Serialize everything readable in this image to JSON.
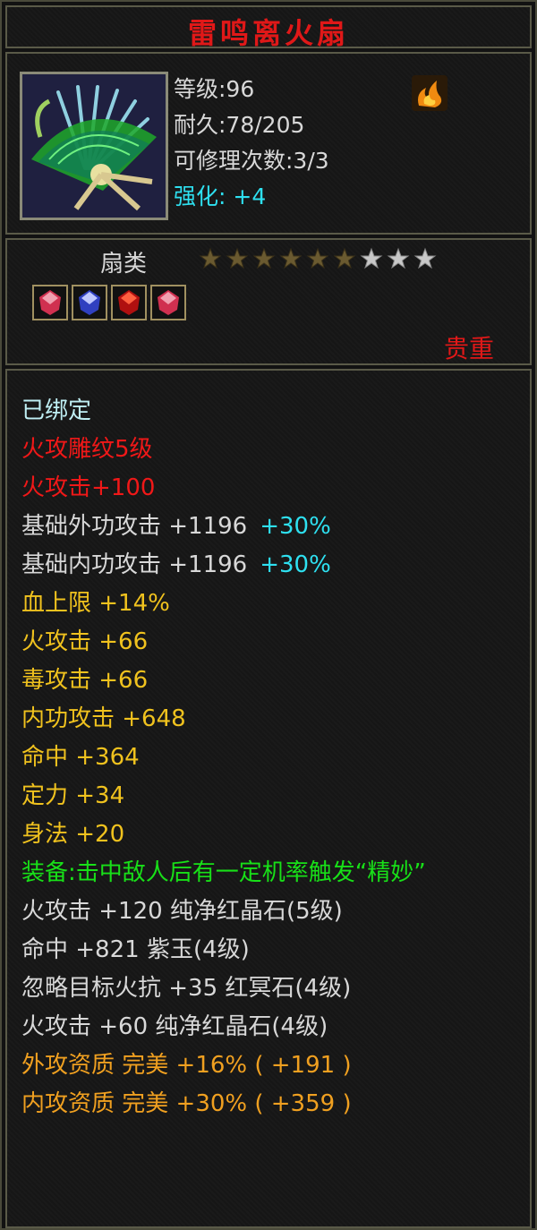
{
  "item": {
    "name": "雷鸣离火扇"
  },
  "header": {
    "level": "等级:96",
    "durability": "耐久:78/205",
    "repair": "可修理次数:3/3",
    "enhance_label": "强化:",
    "enhance_value": "+4"
  },
  "sub": {
    "kind": "扇类",
    "stars_total": 9,
    "stars_lit": 6,
    "grade": "贵重",
    "gems": [
      "pink-gem-icon",
      "blue-gem-icon",
      "red-gem-icon",
      "pink-gem-icon"
    ]
  },
  "attrs": {
    "bound": "已绑定",
    "carve": "火攻雕纹5级",
    "fire_atk_carve": "火攻击+100",
    "base_ext_atk": "基础外功攻击  +1196",
    "base_ext_pct": "+30%",
    "base_int_atk": "基础内功攻击  +1196",
    "base_int_pct": "+30%",
    "hp_max": "血上限  +14%",
    "fire_atk": "火攻击  +66",
    "poison_atk": "毒攻击  +66",
    "int_atk": "内功攻击  +648",
    "hit": "命中  +364",
    "focus": "定力  +34",
    "agility": "身法  +20",
    "equip_effect": "装备:击中敌人后有一定机率触发“精妙”",
    "gem1": "火攻击  +120  纯净红晶石(5级)",
    "gem2": "命中  +821  紫玉(4级)",
    "gem3": "忽略目标火抗  +35  红冥石(4级)",
    "gem4": "火攻击  +60  纯净红晶石(4级)",
    "ext_aptitude": "外攻资质    完美  +16% ( +191 )",
    "int_aptitude": "内攻资质    完美  +30% ( +359 )"
  },
  "colors": {
    "title": "#e01818",
    "cyan": "#2ee0f0",
    "gold": "#f0c21e",
    "green": "#18e018",
    "orange": "#f0a020"
  }
}
